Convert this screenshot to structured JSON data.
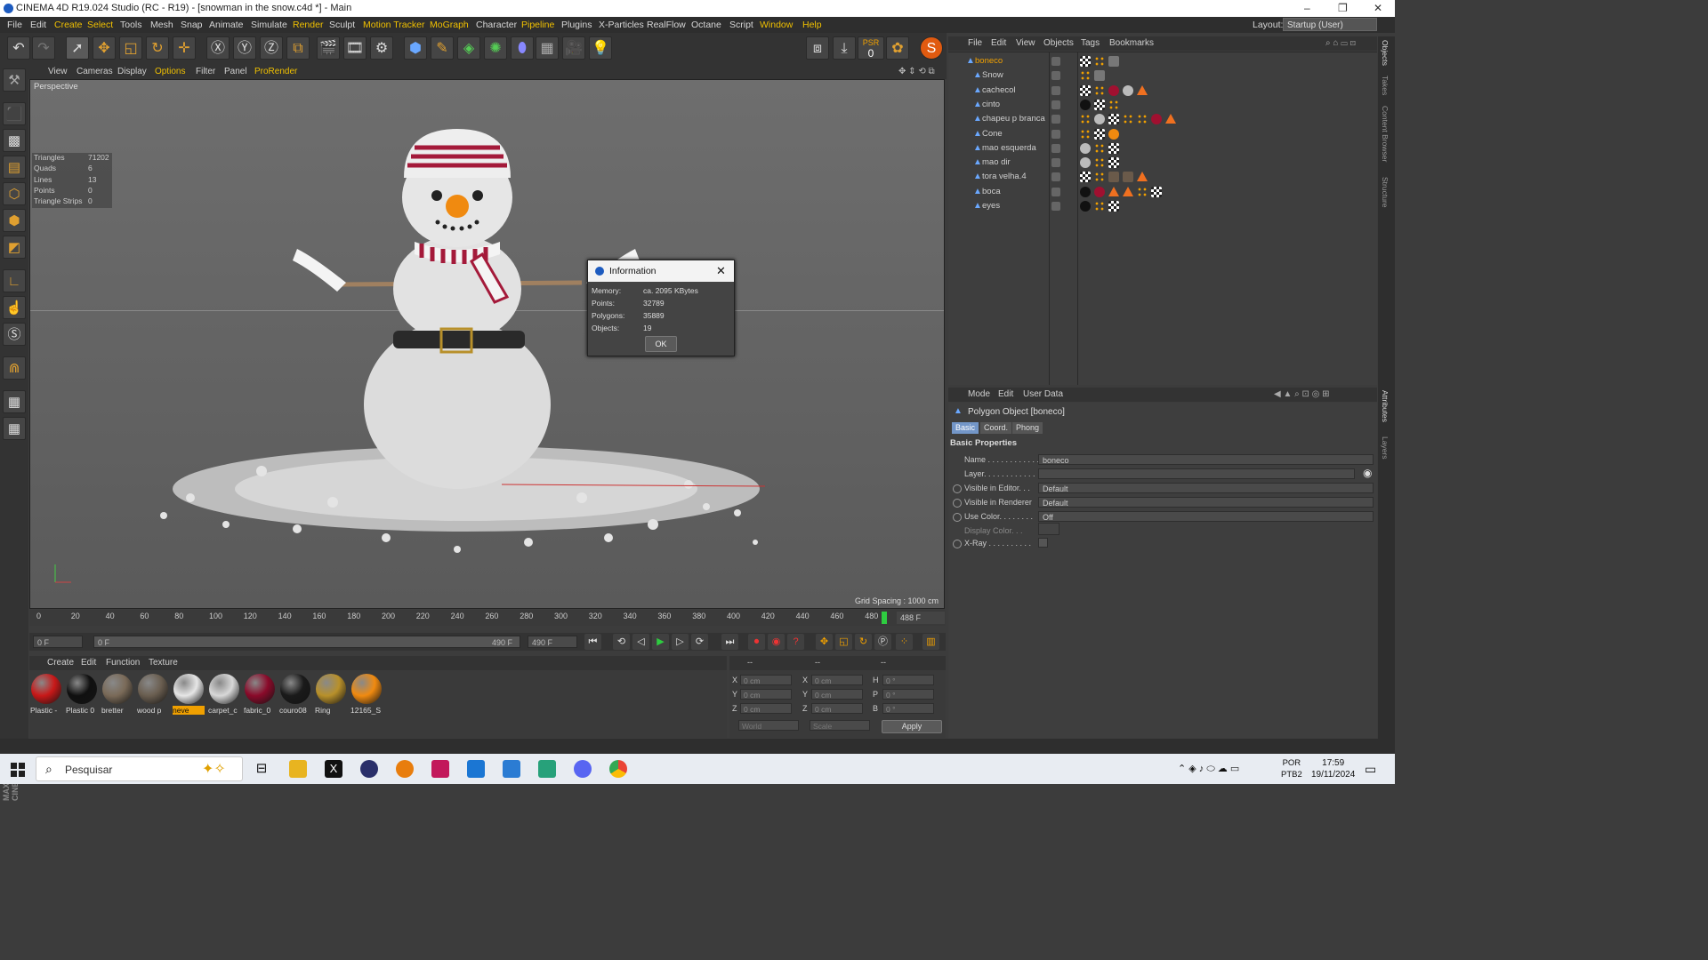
{
  "window": {
    "title": "CINEMA 4D R19.024 Studio (RC - R19) - [snowman in the snow.c4d *] - Main"
  },
  "menubar": {
    "items": [
      "File",
      "Edit",
      "Create",
      "Select",
      "Tools",
      "Mesh",
      "Snap",
      "Animate",
      "Simulate",
      "Render",
      "Sculpt",
      "Motion Tracker",
      "MoGraph",
      "Character",
      "Pipeline",
      "Plugins",
      "X-Particles",
      "RealFlow",
      "Octane",
      "Script",
      "Window",
      "Help"
    ],
    "layout_label": "Layout:",
    "layout_value": "Startup (User)"
  },
  "toolbar": {
    "psr_label": "PSR",
    "psr_value": "0"
  },
  "viewport": {
    "menu": [
      "View",
      "Cameras",
      "Display",
      "Options",
      "Filter",
      "Panel",
      "ProRender"
    ],
    "label": "Perspective",
    "grid_spacing": "Grid Spacing : 1000 cm",
    "stats": [
      {
        "k": "Triangles",
        "v": "71202"
      },
      {
        "k": "Quads",
        "v": "6"
      },
      {
        "k": "Lines",
        "v": "13"
      },
      {
        "k": "Points",
        "v": "0"
      },
      {
        "k": "Triangle Strips",
        "v": "0"
      }
    ]
  },
  "dialog": {
    "title": "Information",
    "rows": [
      {
        "k": "Memory:",
        "v": "ca. 2095 KBytes"
      },
      {
        "k": "Points:",
        "v": "32789"
      },
      {
        "k": "Polygons:",
        "v": "35889"
      },
      {
        "k": "Objects:",
        "v": "19"
      }
    ],
    "ok": "OK"
  },
  "timeline": {
    "ticks": [
      "0",
      "20",
      "40",
      "60",
      "80",
      "100",
      "120",
      "140",
      "160",
      "180",
      "200",
      "220",
      "240",
      "260",
      "280",
      "300",
      "320",
      "340",
      "360",
      "380",
      "400",
      "420",
      "440",
      "460",
      "480"
    ],
    "end_frame": "488 F",
    "start_field": "0 F",
    "range_start": "0 F",
    "range_end": "490 F",
    "max_field": "490 F"
  },
  "materials": {
    "menu": [
      "Create",
      "Edit",
      "Function",
      "Texture"
    ],
    "items": [
      {
        "name": "Plastic -",
        "color": "#c81818"
      },
      {
        "name": "Plastic 0",
        "color": "#101010"
      },
      {
        "name": "bretter",
        "color": "#7a6a58"
      },
      {
        "name": "wood p",
        "color": "#6a5e50"
      },
      {
        "name": "neve",
        "color": "#e6e6e6"
      },
      {
        "name": "carpet_c",
        "color": "#d8d8d8"
      },
      {
        "name": "fabric_0",
        "color": "#8a0a2a"
      },
      {
        "name": "couro08",
        "color": "#1a1a1a"
      },
      {
        "name": "Ring",
        "color": "#b8902a"
      },
      {
        "name": "12165_S",
        "color": "#f08a10"
      }
    ],
    "selected_index": 4
  },
  "coords": {
    "header": [
      "--",
      "--",
      "--"
    ],
    "rows": [
      {
        "a": "X",
        "av": "0 cm",
        "b": "X",
        "bv": "0 cm",
        "c": "H",
        "cv": "0 °"
      },
      {
        "a": "Y",
        "av": "0 cm",
        "b": "Y",
        "bv": "0 cm",
        "c": "P",
        "cv": "0 °"
      },
      {
        "a": "Z",
        "av": "0 cm",
        "b": "Z",
        "bv": "0 cm",
        "c": "B",
        "cv": "0 °"
      }
    ],
    "world": "World",
    "scale": "Scale",
    "apply": "Apply"
  },
  "objects": {
    "menu": [
      "File",
      "Edit",
      "View",
      "Objects",
      "Tags",
      "Bookmarks"
    ],
    "items": [
      {
        "name": "boneco",
        "selected": true,
        "tags": [
          "check",
          "dots",
          "img"
        ]
      },
      {
        "name": "Snow",
        "tags": [
          "dots",
          "img"
        ]
      },
      {
        "name": "cachecol",
        "tags": [
          "check",
          "dots",
          "red",
          "grey",
          "tri"
        ]
      },
      {
        "name": "cinto",
        "tags": [
          "black",
          "check",
          "dots"
        ]
      },
      {
        "name": "chapeu p branca",
        "tags": [
          "dots",
          "grey",
          "check",
          "dots",
          "dots",
          "red",
          "tri"
        ]
      },
      {
        "name": "Cone",
        "tags": [
          "dots",
          "check",
          "orange"
        ]
      },
      {
        "name": "mao esquerda",
        "tags": [
          "grey",
          "dots",
          "check"
        ]
      },
      {
        "name": "mao dir",
        "tags": [
          "grey",
          "dots",
          "check"
        ]
      },
      {
        "name": "tora velha.4",
        "tags": [
          "check",
          "dots",
          "wood",
          "wood",
          "tri"
        ]
      },
      {
        "name": "boca",
        "tags": [
          "black",
          "red",
          "tri",
          "tri",
          "dots",
          "check"
        ]
      },
      {
        "name": "eyes",
        "tags": [
          "black",
          "dots",
          "check"
        ]
      }
    ]
  },
  "attributes": {
    "menu": [
      "Mode",
      "Edit",
      "User Data"
    ],
    "title": "Polygon Object [boneco]",
    "tabs": [
      "Basic",
      "Coord.",
      "Phong"
    ],
    "section": "Basic Properties",
    "fields": [
      {
        "label": "Name . . . . . . . . . . . .",
        "value": "boneco"
      },
      {
        "label": "Layer. . . . . . . . . . . .",
        "value": ""
      },
      {
        "label": "Visible in Editor. . .",
        "value": "Default"
      },
      {
        "label": "Visible in Renderer",
        "value": "Default"
      },
      {
        "label": "Use Color. . . . . . . .",
        "value": "Off"
      },
      {
        "label": "Display Color. . .",
        "value": ""
      },
      {
        "label": "X-Ray . . . . . . . . . .",
        "value": ""
      }
    ]
  },
  "right_tabs": [
    "Objects",
    "Takes",
    "Content Browser",
    "Structure",
    "Attributes",
    "Layers"
  ],
  "taskbar": {
    "search": "Pesquisar",
    "lang_1": "POR",
    "lang_2": "PTB2",
    "time": "17:59",
    "date": "19/11/2024"
  },
  "colors": {
    "accent": "#f0a000",
    "selection": "#7396c8",
    "playhead": "#2ecc40"
  }
}
